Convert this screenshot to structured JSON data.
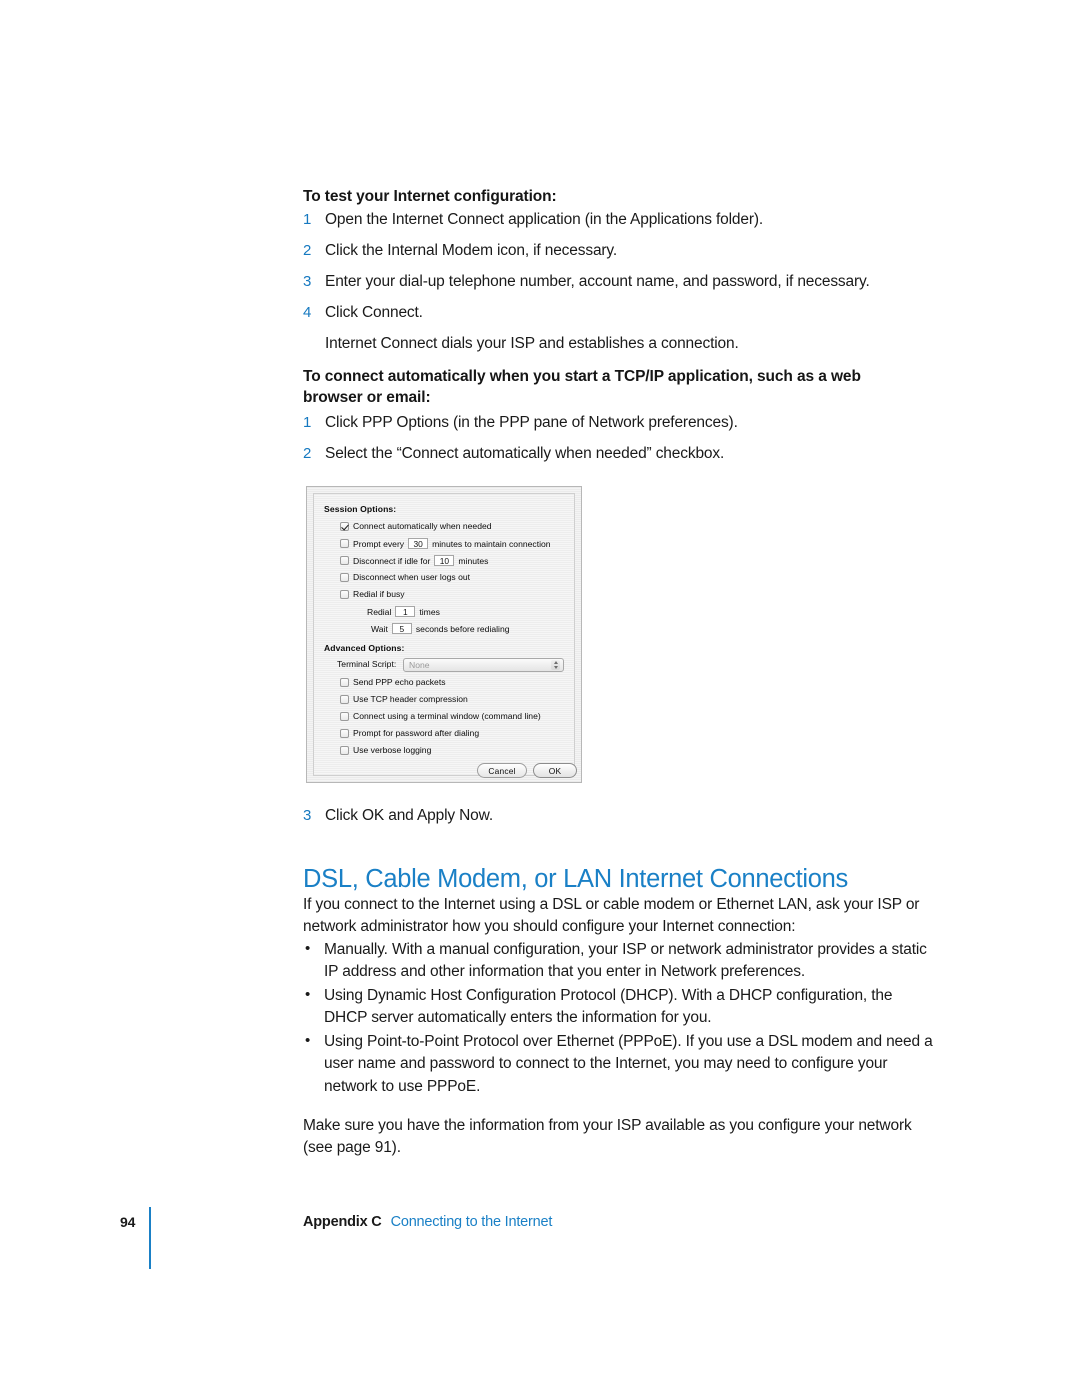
{
  "colors": {
    "accent_blue": "#1a80c6",
    "step_number_blue": "#1679c0",
    "body_text": "#1a1a1a"
  },
  "sections": {
    "test_config": {
      "heading": "To test your Internet configuration:",
      "steps": [
        {
          "num": "1",
          "text": "Open the Internet Connect application (in the Applications folder)."
        },
        {
          "num": "2",
          "text": "Click the Internal Modem icon, if necessary."
        },
        {
          "num": "3",
          "text": "Enter your dial-up telephone number, account name, and password, if necessary."
        },
        {
          "num": "4",
          "text": "Click Connect."
        }
      ],
      "note": "Internet Connect dials your ISP and establishes a connection."
    },
    "auto_connect": {
      "heading": "To connect automatically when you start a TCP/IP application, such as a web browser or email:",
      "steps": [
        {
          "num": "1",
          "text": "Click PPP Options (in the PPP pane of Network preferences)."
        },
        {
          "num": "2",
          "text": "Select the “Connect automatically when needed” checkbox."
        }
      ],
      "final_step": {
        "num": "3",
        "text": "Click OK and Apply Now."
      }
    },
    "dsl_section": {
      "title": "DSL, Cable Modem, or LAN Internet Connections",
      "intro": "If you connect to the Internet using a DSL or cable modem or Ethernet LAN, ask your ISP or network administrator how you should configure your Internet connection:",
      "bullets": [
        "Manually. With a manual configuration, your ISP or network administrator provides a static IP address and other information that you enter in Network preferences.",
        "Using Dynamic Host Configuration Protocol (DHCP). With a DHCP configuration, the DHCP server automatically enters the information for you.",
        "Using Point-to-Point Protocol over Ethernet (PPPoE). If you use a DSL modem and need a user name and password to connect to the Internet, you may need to configure your network to use PPPoE."
      ],
      "closing": "Make sure you have the information from your ISP available as you configure your network (see page 91)."
    }
  },
  "dialog": {
    "session_options_title": "Session Options:",
    "session_rows": [
      {
        "checked": true,
        "label": "Connect automatically when needed"
      },
      {
        "checked": false,
        "label_before": "Prompt every",
        "value": "30",
        "label_after": "minutes to maintain connection"
      },
      {
        "checked": false,
        "label_before": "Disconnect if idle for",
        "value": "10",
        "label_after": "minutes"
      },
      {
        "checked": false,
        "label": "Disconnect when user logs out"
      },
      {
        "checked": false,
        "label": "Redial if busy"
      }
    ],
    "redial_row": {
      "label_before": "Redial",
      "value": "1",
      "label_after": "times"
    },
    "wait_row": {
      "label_before": "Wait",
      "value": "5",
      "label_after": "seconds before redialing"
    },
    "advanced_options_title": "Advanced Options:",
    "terminal_script_label": "Terminal Script:",
    "terminal_script_value": "None",
    "advanced_rows": [
      {
        "checked": false,
        "label": "Send PPP echo packets"
      },
      {
        "checked": false,
        "label": "Use TCP header compression"
      },
      {
        "checked": false,
        "label": "Connect using a terminal window (command line)"
      },
      {
        "checked": false,
        "label": "Prompt for password after dialing"
      },
      {
        "checked": false,
        "label": "Use verbose logging"
      }
    ],
    "cancel_label": "Cancel",
    "ok_label": "OK"
  },
  "footer": {
    "page_number": "94",
    "appendix": "Appendix C",
    "link": "Connecting to the Internet"
  }
}
